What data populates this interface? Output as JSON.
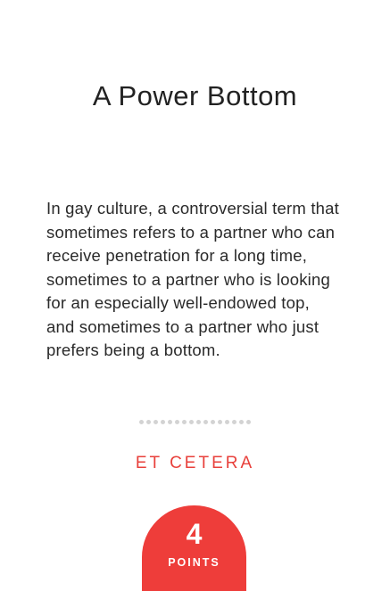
{
  "card": {
    "title": "A Power Bottom",
    "definition": "In gay culture, a controversial term that sometimes refers to a partner who can receive penetration for a long time, sometimes to a partner who is looking for an especially well-endowed top, and sometimes to a partner who just prefers being a bottom.",
    "category": "ET CETERA",
    "points_value": "4",
    "points_label": "POINTS"
  },
  "colors": {
    "accent": "#ee3d3a",
    "category_text": "#e8403b",
    "dot": "#d3d3d3",
    "text": "#222222"
  }
}
